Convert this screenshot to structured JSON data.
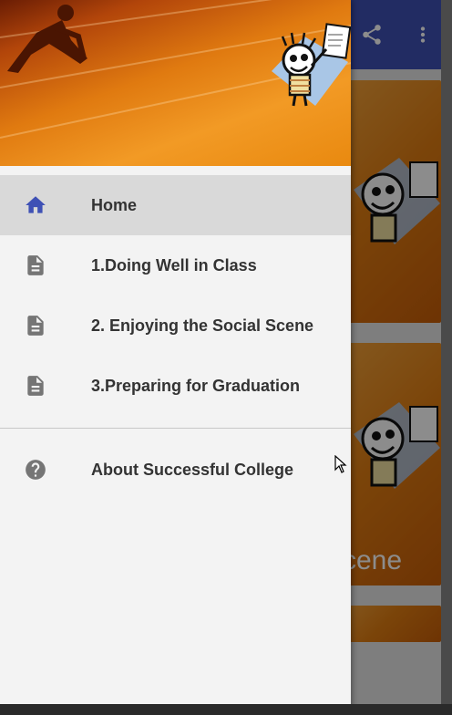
{
  "background_app": {
    "card_caption": "cene",
    "icons": [
      "share-icon",
      "more-vert-icon"
    ]
  },
  "drawer": {
    "menu": [
      {
        "label": "Home",
        "icon": "home-icon",
        "active": true
      },
      {
        "label": "1.Doing Well in Class",
        "icon": "document-icon",
        "active": false
      },
      {
        "label": "2. Enjoying the Social Scene",
        "icon": "document-icon",
        "active": false
      },
      {
        "label": "3.Preparing for Graduation",
        "icon": "document-icon",
        "active": false
      },
      {
        "label": "About Successful College",
        "icon": "help-icon",
        "active": false
      }
    ]
  },
  "colors": {
    "primary": "#3f51b5",
    "icon_active": "#3f51b5",
    "icon_inactive": "#757575",
    "header_orange": "#e07a10"
  }
}
